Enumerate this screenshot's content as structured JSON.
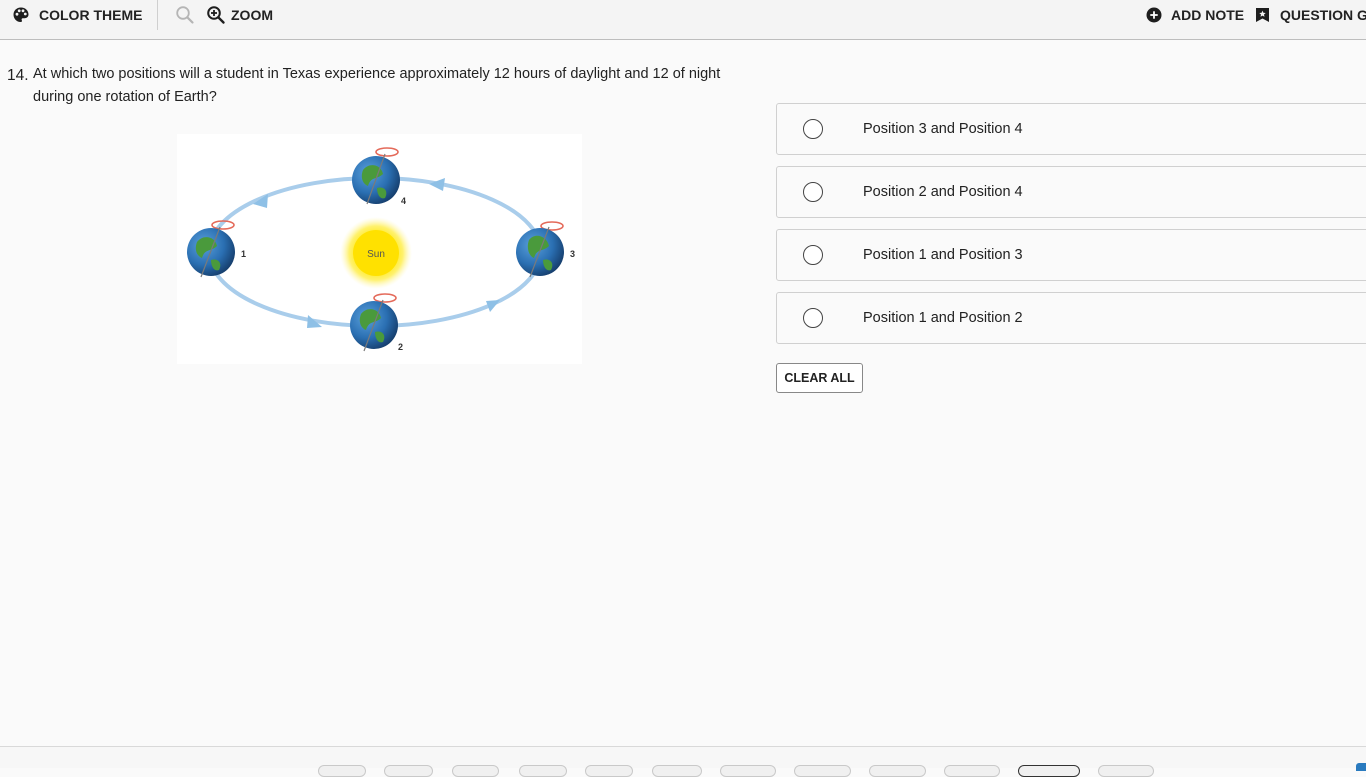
{
  "toolbar": {
    "color_theme_label": "COLOR THEME",
    "zoom_label": "ZOOM",
    "add_note_label": "ADD NOTE",
    "question_guide_label": "QUESTION GU"
  },
  "question": {
    "number": "14.",
    "text": "At which two positions will a student in Texas experience approximately 12 hours of daylight and 12 of night during one rotation of Earth?"
  },
  "figure": {
    "sun_label": "Sun",
    "position_labels": [
      "1",
      "2",
      "3",
      "4"
    ]
  },
  "options": [
    {
      "label": "Position 3 and Position 4",
      "selected": false
    },
    {
      "label": "Position 2 and Position 4",
      "selected": false
    },
    {
      "label": "Position 1 and Position 3",
      "selected": false
    },
    {
      "label": "Position 1 and Position 2",
      "selected": false
    }
  ],
  "clear_all_label": "CLEAR ALL",
  "colors": {
    "orbit": "#a9cdeb",
    "orbit_arrow": "#8ec0e6",
    "sun": "#ffe600",
    "ocean": "#2c6fb4",
    "land": "#4a9a3c",
    "halo": "#e46a5a"
  }
}
